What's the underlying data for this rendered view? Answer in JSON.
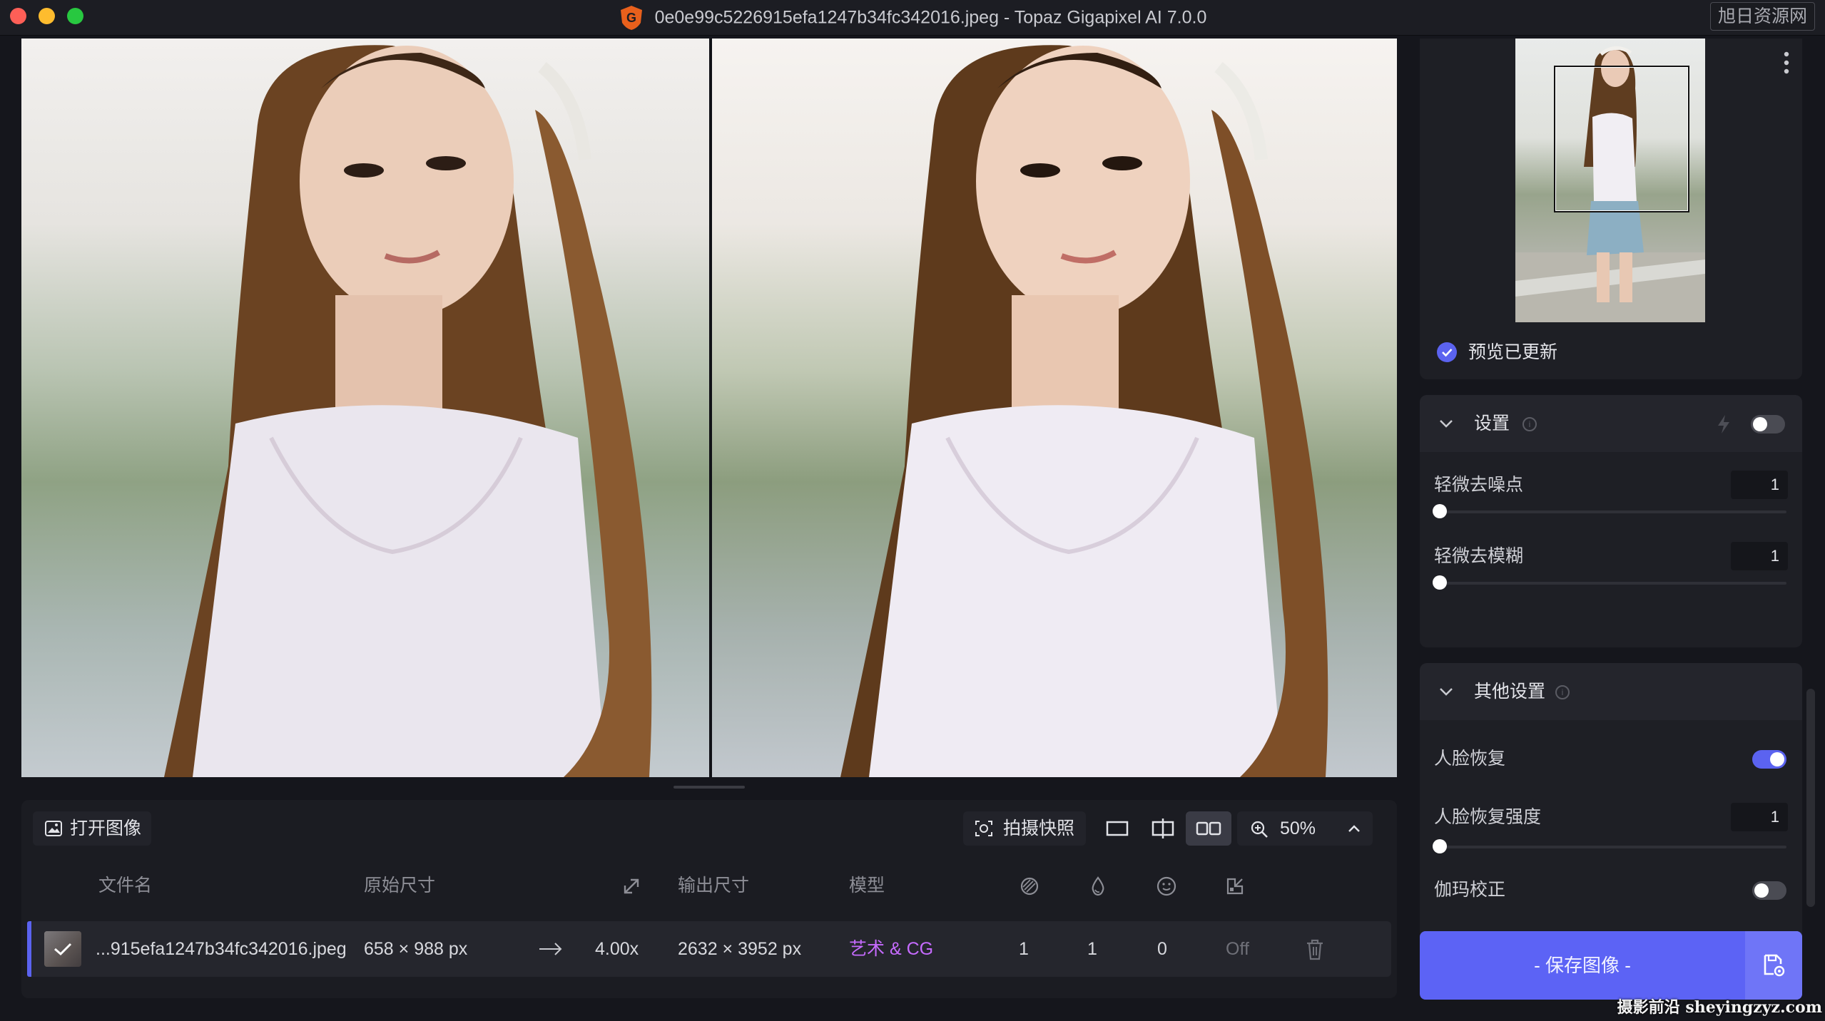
{
  "window": {
    "title": "0e0e99c5226915efa1247b34fc342016.jpeg - Topaz Gigapixel AI 7.0.0",
    "watermark_top": "旭日资源网",
    "watermark_bottom": "摄影前沿 sheyingzyz.com"
  },
  "toolbar": {
    "open_label": "打开图像",
    "snapshot_label": "拍摄快照",
    "zoom_value": "50%"
  },
  "table": {
    "headers": {
      "filename": "文件名",
      "original_size": "原始尺寸",
      "output_size": "输出尺寸",
      "model": "模型"
    },
    "rows": [
      {
        "filename": "...915efa1247b34fc342016.jpeg",
        "original_size": "658 × 988 px",
        "scale": "4.00x",
        "output_size": "2632 × 3952 px",
        "model": "艺术 & CG",
        "denoise": "1",
        "deblur": "1",
        "face": "0",
        "gamma": "Off"
      }
    ]
  },
  "sidebar": {
    "preview_status": "预览已更新",
    "settings": {
      "title": "设置",
      "fields": [
        {
          "label": "轻微去噪点",
          "value": "1"
        },
        {
          "label": "轻微去模糊",
          "value": "1"
        }
      ],
      "enabled": false
    },
    "other": {
      "title": "其他设置",
      "face_recovery_label": "人脸恢复",
      "face_recovery_on": true,
      "face_strength_label": "人脸恢复强度",
      "face_strength_value": "1",
      "gamma_label": "伽玛校正",
      "gamma_on": false
    },
    "save_label": "- 保存图像 -"
  },
  "colors": {
    "accent": "#5c63f5",
    "model_text": "#c66bff"
  }
}
